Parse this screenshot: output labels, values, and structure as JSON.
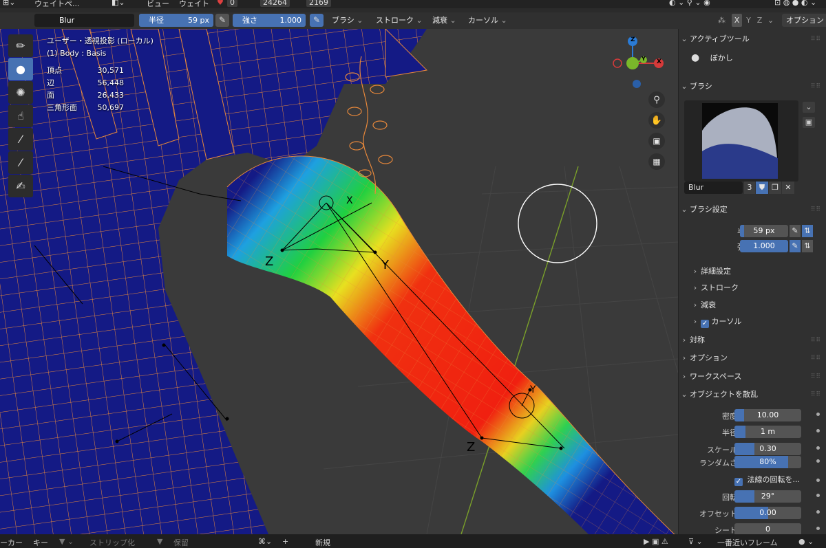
{
  "header": {
    "mode": "ウェイトペ...",
    "menu": [
      "ビュー",
      "ウェイト"
    ],
    "count_a": "0",
    "count_b": "24264",
    "count_c": "2169"
  },
  "toolbar": {
    "brush_name": "Blur",
    "radius_label": "半径",
    "radius_value": "59 px",
    "strength_label": "強さ",
    "strength_value": "1.000",
    "menus": [
      "ブラシ",
      "ストローク",
      "減衰",
      "カーソル"
    ],
    "axes": [
      "X",
      "Y",
      "Z"
    ],
    "options": "オプション"
  },
  "viewport": {
    "view_name": "ユーザー・透視投影 (ローカル)",
    "object_name": "(1) Body : Basis",
    "stats": [
      {
        "label": "頂点",
        "value": "30,571"
      },
      {
        "label": "辺",
        "value": "56,448"
      },
      {
        "label": "面",
        "value": "26,433"
      },
      {
        "label": "三角形面",
        "value": "50,697"
      }
    ],
    "gizmo_labels": [
      "Z",
      "Y",
      "X"
    ],
    "bone_labels": [
      "X",
      "Y",
      "Z",
      "Y",
      "Z"
    ]
  },
  "sidebar": {
    "active_tool_header": "アクティブツール",
    "active_tool": "ぼかし",
    "brush_header": "ブラシ",
    "brush_name": "Blur",
    "brush_users": "3",
    "brush_settings_header": "ブラシ設定",
    "radius_label": "半径",
    "radius_value": "59 px",
    "strength_label": "強さ",
    "strength_value": "1.000",
    "subsections": [
      "詳細設定",
      "ストローク",
      "減衰",
      "カーソル"
    ],
    "sections": [
      "対称",
      "オプション",
      "ワークスペース"
    ],
    "scatter_header": "オブジェクトを散乱",
    "scatter": [
      {
        "label": "密度",
        "value": "10.00",
        "fill": 0.1
      },
      {
        "label": "半径",
        "value": "1 m",
        "fill": 0.12
      },
      {
        "label": "スケール",
        "value": "0.30",
        "fill": 0.3
      },
      {
        "label": "ランダムさ",
        "value": "80%",
        "fill": 0.8
      }
    ],
    "normal_rotation": "法線の回転を...",
    "scatter2": [
      {
        "label": "回転",
        "value": "29°",
        "fill": 0.3
      },
      {
        "label": "オフセット",
        "value": "0.00",
        "fill": 0.5
      },
      {
        "label": "シード",
        "value": "0",
        "fill": 0.0
      }
    ]
  },
  "statusbar": {
    "items": [
      "ーカー",
      "キー",
      "ストリップ化",
      "保留",
      "新規",
      "一番近いフレーム"
    ]
  },
  "colors": {
    "accent": "#4772b3",
    "weight_zero": "#141a85",
    "wire": "#e8883a"
  }
}
